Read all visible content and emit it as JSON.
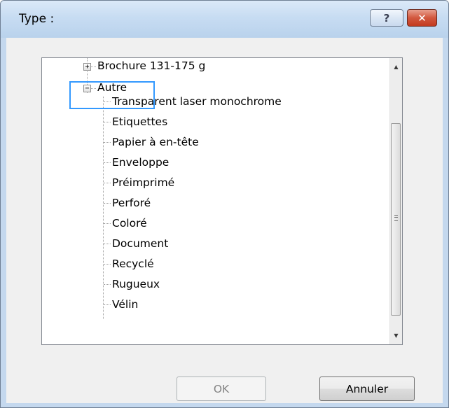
{
  "window": {
    "title": "Type :",
    "help_glyph": "?",
    "close_glyph": "✕"
  },
  "tree": {
    "partial_item": "Brochure 131-175 g",
    "partial_expander": "+",
    "expanded_item": "Autre",
    "expanded_expander": "−",
    "children": [
      "Transparent laser monochrome",
      "Etiquettes",
      "Papier à en-tête",
      "Enveloppe",
      "Préimprimé",
      "Perforé",
      "Coloré",
      "Document",
      "Recyclé",
      "Rugueux",
      "Vélin"
    ]
  },
  "scrollbar": {
    "up_glyph": "▲",
    "down_glyph": "▼"
  },
  "buttons": {
    "ok_label": "OK",
    "cancel_label": "Annuler"
  },
  "colors": {
    "focus_border": "#3399ff",
    "close_button": "#c23a1f",
    "dialog_background": "#f0f0f0"
  }
}
